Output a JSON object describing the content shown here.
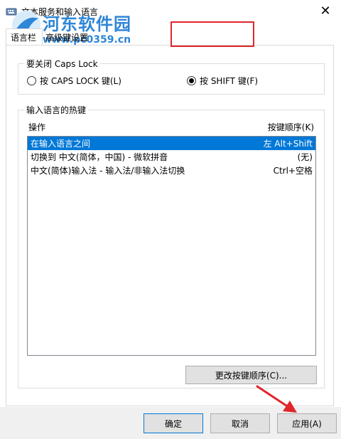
{
  "window": {
    "title": "文本服务和输入语言",
    "close_glyph": "✕"
  },
  "watermark": {
    "site_name": "河东软件园",
    "url": "www.pc0359.cn"
  },
  "tabs": [
    {
      "label": "语言栏"
    },
    {
      "label": "高级键设置"
    }
  ],
  "caps_lock": {
    "group_label": "要关闭 Caps Lock",
    "option_caps": "按 CAPS LOCK 键(L)",
    "option_shift": "按 SHIFT 键(F)",
    "selected": "shift"
  },
  "hotkeys": {
    "group_label": "输入语言的热键",
    "col_action": "操作",
    "col_sequence": "按键顺序(K)",
    "rows": [
      {
        "action": "在输入语言之间",
        "sequence": "左 Alt+Shift",
        "selected": true
      },
      {
        "action": "切换到 中文(简体，中国) - 微软拼音",
        "sequence": "(无)",
        "selected": false
      },
      {
        "action": "中文(简体)输入法 - 输入法/非输入法切换",
        "sequence": "Ctrl+空格",
        "selected": false
      }
    ],
    "change_button": "更改按键顺序(C)..."
  },
  "footer": {
    "ok": "确定",
    "cancel": "取消",
    "apply": "应用(A)"
  },
  "colors": {
    "selection": "#0078d7",
    "highlight": "#e0262b",
    "watermark": "#2e86d6"
  }
}
